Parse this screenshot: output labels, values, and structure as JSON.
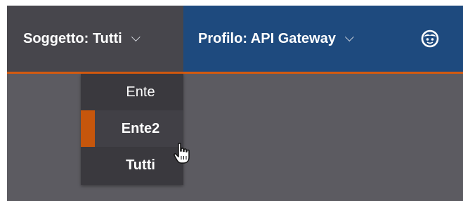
{
  "header": {
    "subject_menu_label": "Soggetto: Tutti",
    "profile_menu_label": "Profilo: API Gateway",
    "user_icon": "user-face-icon"
  },
  "subject_dropdown": {
    "items": [
      {
        "label": "Ente",
        "state": "normal"
      },
      {
        "label": "Ente2",
        "state": "selected"
      },
      {
        "label": "Tutti",
        "state": "bold"
      }
    ]
  },
  "pointer": "hand-pointer-icon",
  "colors": {
    "header_bg": "#1e4a7e",
    "subject_menu_bg": "#47464c",
    "accent": "#d35a10",
    "content_bg": "#5c5b61",
    "dropdown_bg": "#3a393e"
  }
}
